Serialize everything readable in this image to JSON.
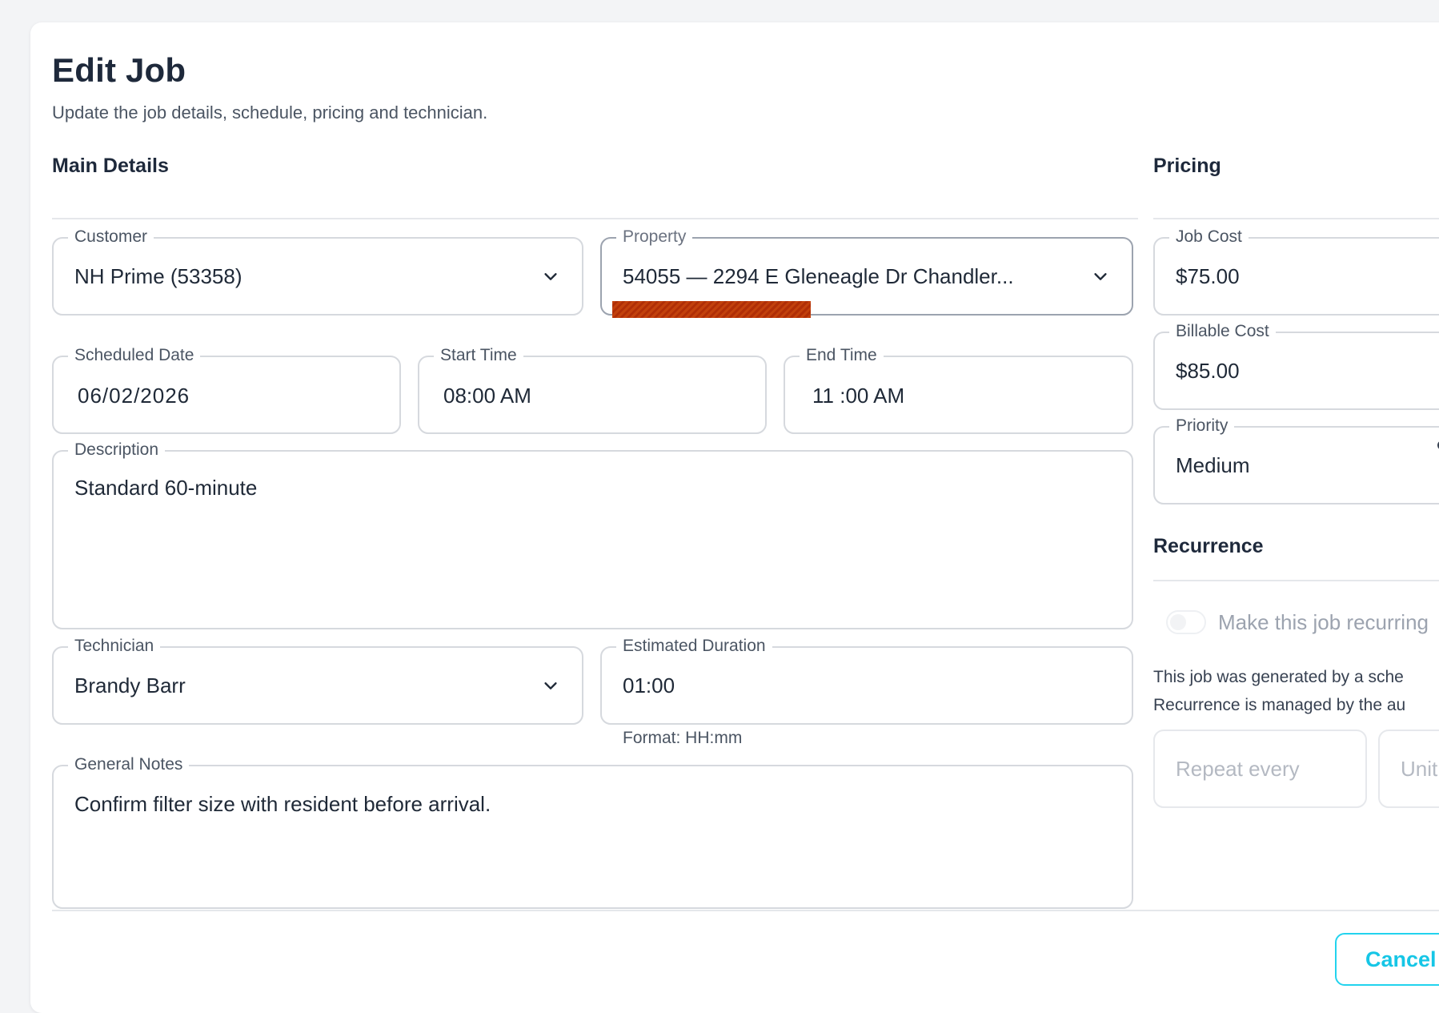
{
  "header": {
    "title": "Edit Job",
    "subtitle": "Update the job details, schedule, pricing and technician."
  },
  "main_details": {
    "section_title": "Main Details",
    "customer": {
      "label": "Customer",
      "value": "NH Prime (53358)"
    },
    "property": {
      "label": "Property",
      "value": "54055 — 2294 E Gleneagle Dr Chandler..."
    },
    "scheduled_date": {
      "label": "Scheduled Date",
      "value": "06/02/2026"
    },
    "start_time": {
      "label": "Start Time",
      "value": "08:00 AM"
    },
    "end_time": {
      "label": "End Time",
      "value": "11 :00 AM"
    },
    "description": {
      "label": "Description",
      "value": "Standard 60-minute"
    },
    "technician": {
      "label": "Technician",
      "value": "Brandy Barr"
    },
    "estimated_duration": {
      "label": "Estimated Duration",
      "value": "01:00",
      "helper": "Format: HH:mm"
    },
    "general_notes": {
      "label": "General Notes",
      "value": "Confirm filter size with resident before arrival."
    }
  },
  "pricing": {
    "section_title": "Pricing",
    "job_cost": {
      "label": "Job Cost",
      "value": "$75.00"
    },
    "billable_cost": {
      "label": "Billable Cost",
      "value": "$85.00"
    },
    "priority": {
      "label": "Priority",
      "value": "Medium"
    }
  },
  "recurrence": {
    "section_title": "Recurrence",
    "toggle_label": "Make this job recurring",
    "toggle_on": false,
    "info_line1": "This job was generated by a sche",
    "info_line2": "Recurrence is managed by the au",
    "repeat_every_placeholder": "Repeat every",
    "unit_placeholder": "Unit"
  },
  "footer": {
    "cancel_label": "Cancel"
  },
  "colors": {
    "accent": "#22d3ee",
    "error": "#c2410c",
    "text_primary": "#1e293b",
    "border": "#d6d9de"
  }
}
